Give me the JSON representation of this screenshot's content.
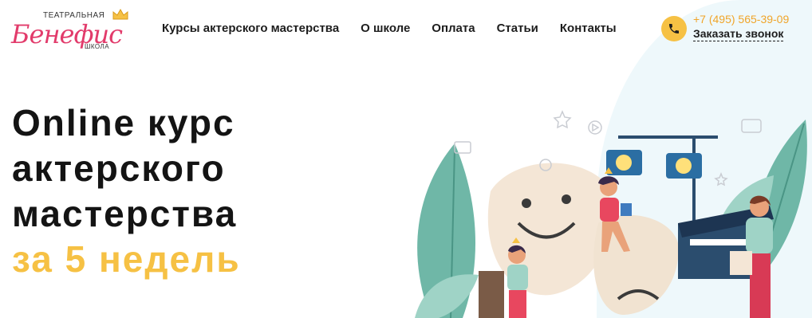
{
  "logo": {
    "top_text": "ТЕАТРАЛЬНАЯ",
    "script_text": "Бенефис",
    "bottom_text": "ШКОЛА"
  },
  "nav": {
    "items": [
      {
        "label": "Курсы актерского мастерства"
      },
      {
        "label": "О школе"
      },
      {
        "label": "Оплата"
      },
      {
        "label": "Статьи"
      },
      {
        "label": "Контакты"
      }
    ]
  },
  "contact": {
    "phone": "+7 (495) 565-39-09",
    "callback_label": "Заказать звонок",
    "icon": "phone-icon"
  },
  "hero": {
    "line1": "Online курс",
    "line2": "актерского",
    "line3": "мастерства",
    "line4": "за 5 недель"
  },
  "colors": {
    "accent": "#f6c144",
    "brand": "#e23b6b",
    "text": "#1d1d1d"
  }
}
